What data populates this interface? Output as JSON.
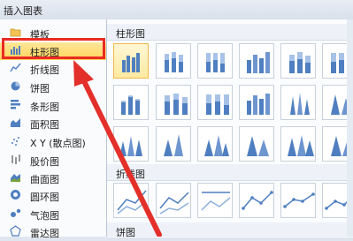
{
  "window": {
    "title": "插入图表"
  },
  "sidebar": {
    "items": [
      {
        "label": "模板",
        "icon": "folder-icon"
      },
      {
        "label": "柱形图",
        "icon": "column-chart-icon"
      },
      {
        "label": "折线图",
        "icon": "line-chart-icon"
      },
      {
        "label": "饼图",
        "icon": "pie-chart-icon"
      },
      {
        "label": "条形图",
        "icon": "bar-chart-icon"
      },
      {
        "label": "面积图",
        "icon": "area-chart-icon"
      },
      {
        "label": "X Y (散点图)",
        "icon": "scatter-chart-icon"
      },
      {
        "label": "股价图",
        "icon": "stock-chart-icon"
      },
      {
        "label": "曲面图",
        "icon": "surface-chart-icon"
      },
      {
        "label": "圆环图",
        "icon": "doughnut-chart-icon"
      },
      {
        "label": "气泡图",
        "icon": "bubble-chart-icon"
      },
      {
        "label": "雷达图",
        "icon": "radar-chart-icon"
      }
    ],
    "selected_index": 1
  },
  "sections": {
    "column": {
      "title": "柱形图"
    },
    "line": {
      "title": "折线图"
    },
    "pie": {
      "title": "饼图"
    }
  },
  "colors": {
    "accent_red": "#ea2b24",
    "selection_yellow": "#ffd35a",
    "chart_blue": "#4f7fc0"
  }
}
